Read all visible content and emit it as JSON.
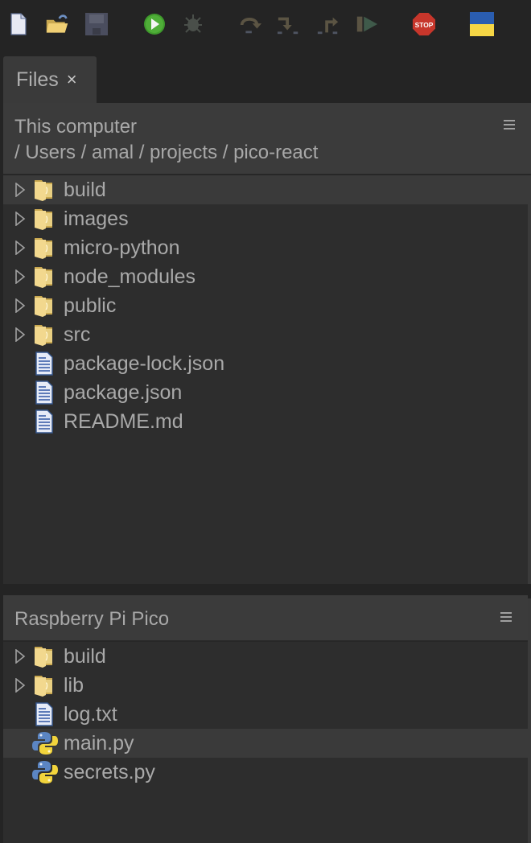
{
  "toolbar": {
    "buttons": [
      {
        "name": "new-file",
        "icon": "new-file-icon",
        "enabled": true
      },
      {
        "name": "open-file",
        "icon": "open-folder-icon",
        "enabled": true
      },
      {
        "name": "save",
        "icon": "save-floppy-icon",
        "enabled": false
      },
      {
        "name": "run",
        "icon": "run-play-icon",
        "enabled": true
      },
      {
        "name": "debug",
        "icon": "debug-bug-icon",
        "enabled": false
      },
      {
        "name": "step-over",
        "icon": "step-over-icon",
        "enabled": false
      },
      {
        "name": "step-into",
        "icon": "step-into-icon",
        "enabled": false
      },
      {
        "name": "step-out",
        "icon": "step-out-icon",
        "enabled": false
      },
      {
        "name": "resume",
        "icon": "resume-icon",
        "enabled": false
      },
      {
        "name": "stop",
        "icon": "stop-sign-icon",
        "enabled": true,
        "label": "STOP"
      },
      {
        "name": "ukraine-flag",
        "icon": "ukraine-flag-icon",
        "enabled": true
      }
    ]
  },
  "tab": {
    "label": "Files",
    "close_symbol": "×"
  },
  "local_panel": {
    "title": "This computer",
    "path": "/ Users / amal / projects / pico-react",
    "items": [
      {
        "name": "build",
        "type": "folder",
        "selected": true
      },
      {
        "name": "images",
        "type": "folder",
        "selected": false
      },
      {
        "name": "micro-python",
        "type": "folder",
        "selected": false
      },
      {
        "name": "node_modules",
        "type": "folder",
        "selected": false
      },
      {
        "name": "public",
        "type": "folder",
        "selected": false
      },
      {
        "name": "src",
        "type": "folder",
        "selected": false
      },
      {
        "name": "package-lock.json",
        "type": "file",
        "selected": false
      },
      {
        "name": "package.json",
        "type": "file",
        "selected": false
      },
      {
        "name": "README.md",
        "type": "file",
        "selected": false
      }
    ]
  },
  "device_panel": {
    "title": "Raspberry Pi Pico",
    "items": [
      {
        "name": "build",
        "type": "folder",
        "selected": false
      },
      {
        "name": "lib",
        "type": "folder",
        "selected": false
      },
      {
        "name": "log.txt",
        "type": "file",
        "selected": false
      },
      {
        "name": "main.py",
        "type": "python",
        "selected": true
      },
      {
        "name": "secrets.py",
        "type": "python",
        "selected": false
      }
    ]
  },
  "colors": {
    "background": "#242424",
    "panel": "#2d2d2d",
    "panel_header": "#3b3b3b",
    "selection": "#3a3a3a",
    "text": "#a9a9a9",
    "folder": "#e8cf82",
    "run_green": "#3f9a2c",
    "stop_red": "#c7362b",
    "flag_blue": "#2a5db0",
    "flag_yellow": "#f5d645"
  }
}
